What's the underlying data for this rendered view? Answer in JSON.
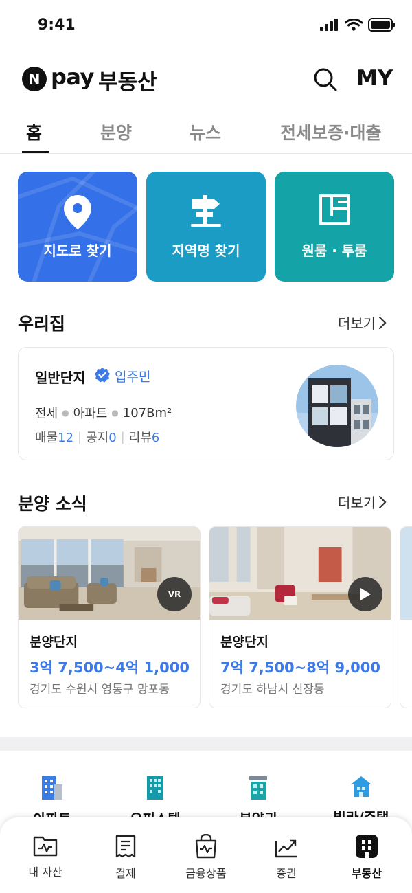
{
  "status": {
    "time": "9:41"
  },
  "header": {
    "logo_letter": "N",
    "logo_pay": "pay",
    "title": "부동산",
    "my_label": "MY"
  },
  "tabs": [
    {
      "label": "홈",
      "active": true
    },
    {
      "label": "분양",
      "active": false
    },
    {
      "label": "뉴스",
      "active": false
    },
    {
      "label": "전세보증·대출",
      "active": false
    }
  ],
  "quick_tiles": [
    {
      "label": "지도로 찾기",
      "icon": "map-pin-icon",
      "color": "#3470e8"
    },
    {
      "label": "지역명 찾기",
      "icon": "signpost-icon",
      "color": "#1a9cc4"
    },
    {
      "label": "원룸 · 투룸",
      "icon": "floorplan-icon",
      "color": "#14a3a6"
    }
  ],
  "home_section": {
    "title": "우리집",
    "more": "더보기",
    "complex_name": "일반단지",
    "resident_label": "입주민",
    "spec": [
      "전세",
      "아파트",
      "107Bm²"
    ],
    "counts": [
      {
        "label": "매물",
        "value": "12"
      },
      {
        "label": "공지",
        "value": "0"
      },
      {
        "label": "리뷰",
        "value": "6"
      }
    ]
  },
  "presale_section": {
    "title": "분양 소식",
    "more": "더보기",
    "cards": [
      {
        "name": "분양단지",
        "price": "3억 7,500~4억 1,000",
        "address": "경기도 수원시 영통구 망포동",
        "badge": "VR"
      },
      {
        "name": "분양단지",
        "price": "7억 7,500~8억 9,000",
        "address": "경기도 하남시 신장동",
        "badge": "play"
      }
    ]
  },
  "categories": [
    {
      "label": "아파트",
      "icon": "apartment-icon"
    },
    {
      "label": "오피스텔",
      "icon": "officetel-icon"
    },
    {
      "label": "분양권",
      "icon": "presale-right-icon"
    },
    {
      "label": "빌라/주택",
      "icon": "house-icon"
    }
  ],
  "bottom_nav": [
    {
      "label": "내 자산",
      "icon": "asset-folder-icon",
      "active": false
    },
    {
      "label": "결제",
      "icon": "receipt-icon",
      "active": false
    },
    {
      "label": "금융상품",
      "icon": "finance-bag-icon",
      "active": false
    },
    {
      "label": "증권",
      "icon": "stock-chart-icon",
      "active": false
    },
    {
      "label": "부동산",
      "icon": "real-estate-icon",
      "active": true
    }
  ],
  "colors": {
    "accent": "#3b7ae8",
    "tile_map": "#3470e8",
    "tile_region": "#1a9cc4",
    "tile_room": "#14a3a6"
  }
}
